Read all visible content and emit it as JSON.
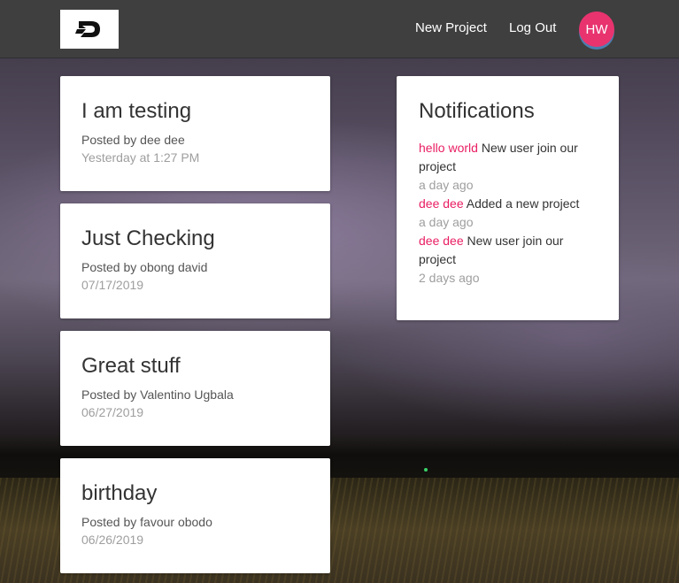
{
  "navbar": {
    "logo_icon": "d-logo-icon",
    "new_project": "New Project",
    "log_out": "Log Out",
    "avatar_initials": "HW",
    "avatar_color": "#e8336f"
  },
  "posts": [
    {
      "title": "I am testing",
      "author": "Posted by dee dee",
      "date": "Yesterday at 1:27 PM"
    },
    {
      "title": "Just Checking",
      "author": "Posted by obong david",
      "date": "07/17/2019"
    },
    {
      "title": "Great stuff",
      "author": "Posted by Valentino Ugbala",
      "date": "06/27/2019"
    },
    {
      "title": "birthday",
      "author": "Posted by favour obodo",
      "date": "06/26/2019"
    }
  ],
  "notifications": {
    "title": "Notifications",
    "items": [
      {
        "user": "hello world",
        "text": " New user join our project",
        "time": "a day ago"
      },
      {
        "user": "dee dee",
        "text": " Added a new project",
        "time": "a day ago"
      },
      {
        "user": "dee dee",
        "text": " New user join our project",
        "time": "2 days ago"
      }
    ],
    "accent_color": "#e91e63"
  }
}
